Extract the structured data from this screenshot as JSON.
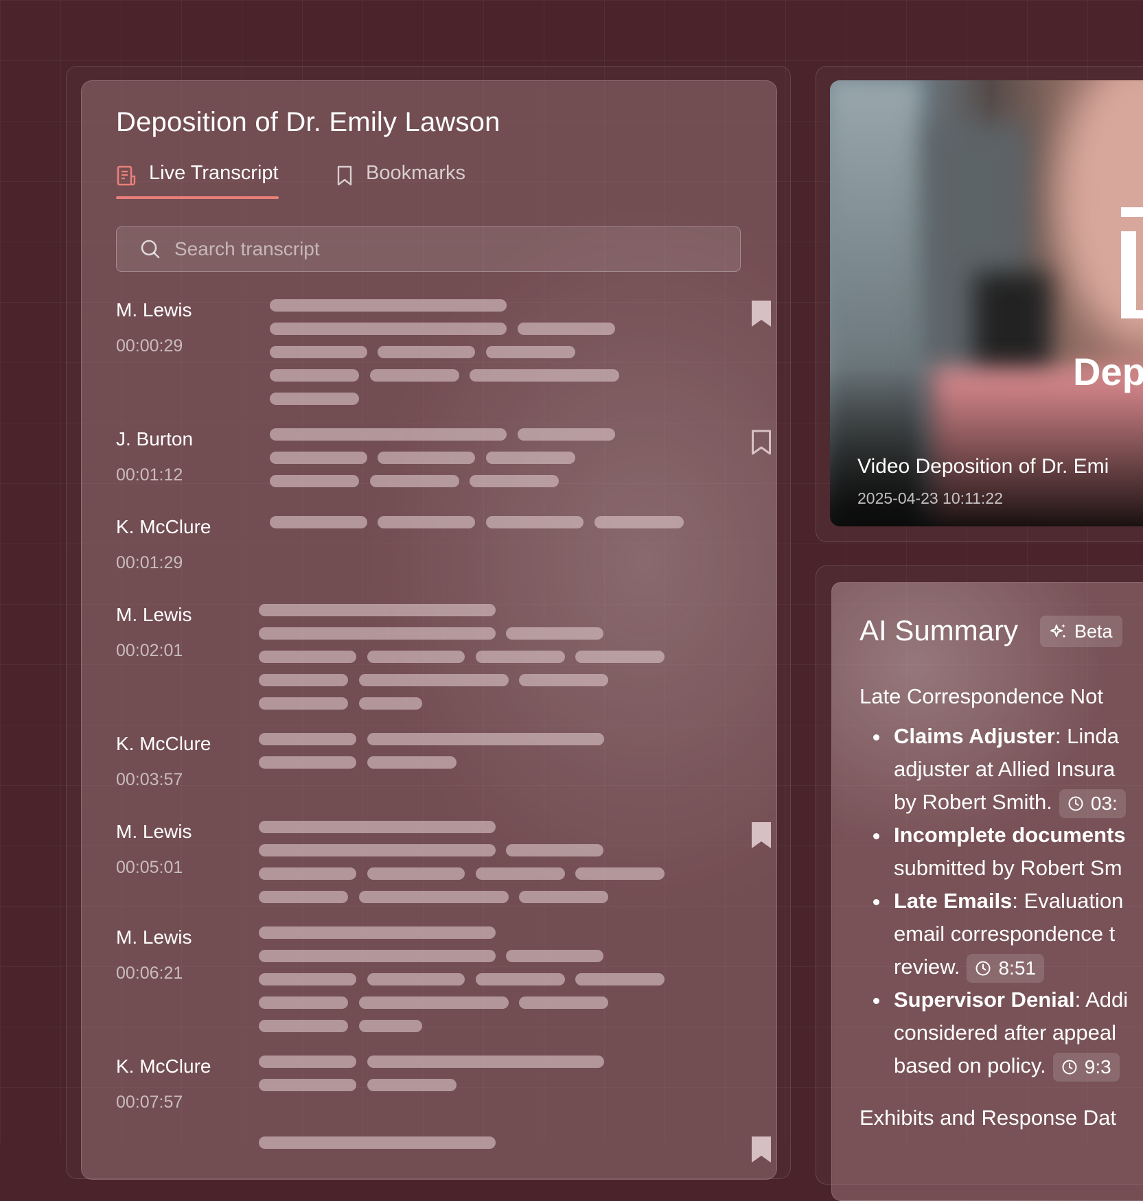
{
  "transcript": {
    "title": "Deposition of Dr. Emily Lawson",
    "tabs": [
      {
        "label": "Live Transcript",
        "active": true,
        "icon": "transcript-icon"
      },
      {
        "label": "Bookmarks",
        "active": false,
        "icon": "bookmark-outline-icon"
      }
    ],
    "search": {
      "placeholder": "Search transcript",
      "value": ""
    },
    "entries": [
      {
        "speaker": "M. Lewis",
        "time": "00:00:29",
        "bookmark": "filled"
      },
      {
        "speaker": "J. Burton",
        "time": "00:01:12",
        "bookmark": "outline"
      },
      {
        "speaker": "K. McClure",
        "time": "00:01:29",
        "bookmark": "none"
      },
      {
        "speaker": "M. Lewis",
        "time": "00:02:01",
        "bookmark": "none"
      },
      {
        "speaker": "K. McClure",
        "time": "00:03:57",
        "bookmark": "none"
      },
      {
        "speaker": "M. Lewis",
        "time": "00:05:01",
        "bookmark": "filled"
      },
      {
        "speaker": "M. Lewis",
        "time": "00:06:21",
        "bookmark": "none"
      },
      {
        "speaker": "K. McClure",
        "time": "00:07:57",
        "bookmark": "none"
      }
    ]
  },
  "video": {
    "overlay_text": "Dep",
    "title": "Video Deposition of Dr. Emi",
    "datetime": "2025-04-23 10:11:22"
  },
  "ai_summary": {
    "title": "AI Summary",
    "badge": "Beta",
    "section_heading": "Late Correspondence Not",
    "bullets": [
      {
        "term": "Claims Adjuster",
        "lines": [
          ": Linda",
          "adjuster at Allied Insura",
          "by Robert Smith."
        ],
        "timestamp": "03:"
      },
      {
        "term": "Incomplete documents",
        "lines": [
          "",
          "submitted by Robert Sm"
        ],
        "timestamp": ""
      },
      {
        "term": "Late Emails",
        "lines": [
          ": Evaluation",
          "email correspondence t",
          "review."
        ],
        "timestamp": "8:51"
      },
      {
        "term": "Supervisor Denial",
        "lines": [
          ": Addi",
          "considered after appeal",
          "based on policy."
        ],
        "timestamp": "9:3"
      }
    ],
    "next_heading": "Exhibits and Response Dat"
  },
  "colors": {
    "background": "#4a242a",
    "accent": "#e8807a",
    "panel": "#8d6a70",
    "placeholder_bar": "#c7abae"
  }
}
